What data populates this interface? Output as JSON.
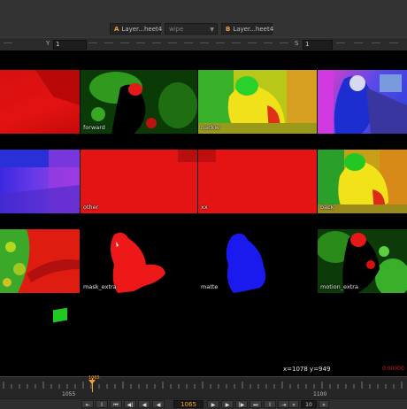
{
  "viewer_toolbar": {
    "input_a": {
      "letter": "A",
      "name": "Layer...heet4"
    },
    "blend_mode": "wipe",
    "input_b": {
      "letter": "B",
      "name": "Layer...heet4"
    },
    "y_label": "Y",
    "y_value": "1",
    "scale_label": "S",
    "scale_value": "1"
  },
  "tiles": [
    {
      "label": ""
    },
    {
      "label": "forward"
    },
    {
      "label": "backw"
    },
    {
      "label": ""
    },
    {
      "label": ""
    },
    {
      "label": "other"
    },
    {
      "label": "xx"
    },
    {
      "label": "back"
    },
    {
      "label": ""
    },
    {
      "label": "mask_extra"
    },
    {
      "label": "matte"
    },
    {
      "label": "motion_extra"
    }
  ],
  "readout": {
    "coords": "x=1078 y=949",
    "value": "0.00000"
  },
  "timeline": {
    "current_frame": "1065",
    "playhead_label": "1065",
    "start_label": "1055",
    "end_label": "1100",
    "step": "10"
  },
  "colors": {
    "accent": "#f4a020",
    "bg": "#000000",
    "panel": "#333333"
  }
}
